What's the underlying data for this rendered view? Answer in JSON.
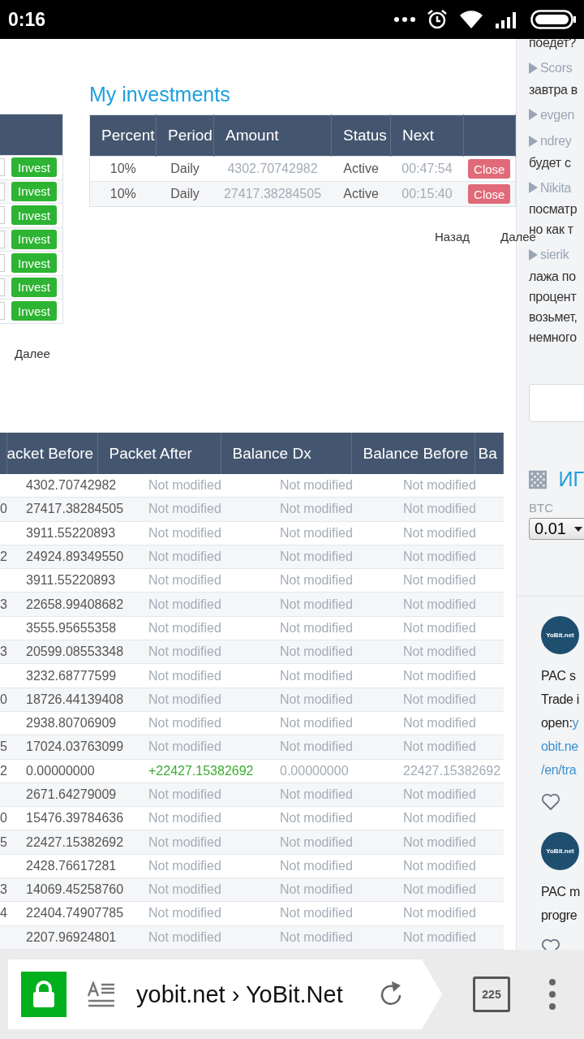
{
  "status_bar": {
    "time": "0:16"
  },
  "left_table": {
    "rows": [
      {
        "button": "Invest"
      },
      {
        "button": "Invest"
      },
      {
        "button": "Invest"
      },
      {
        "button": "Invest"
      },
      {
        "button": "Invest"
      },
      {
        "button": "Invest"
      },
      {
        "button": "Invest"
      }
    ],
    "next": "Далее"
  },
  "investments": {
    "title": "My investments",
    "columns": [
      "Percent",
      "Period",
      "Amount",
      "Status",
      "Next"
    ],
    "rows": [
      {
        "percent": "10%",
        "period": "Daily",
        "amount": "4302.70742982",
        "status": "Active",
        "next": "00:47:54",
        "button": "Close"
      },
      {
        "percent": "10%",
        "period": "Daily",
        "amount": "27417.38284505",
        "status": "Active",
        "next": "00:15:40",
        "button": "Close"
      }
    ],
    "prev": "Назад",
    "next": "Далее"
  },
  "history": {
    "columns": [
      "acket Before",
      "Packet After",
      "Balance Dx",
      "Balance Before",
      "Ba"
    ],
    "rows": [
      {
        "packet_before": "4302.70742982",
        "packet_after": "Not modified",
        "balance_dx": "Not modified",
        "balance_before": "Not modified",
        "modified": false
      },
      {
        "column_1": "0",
        "packet_before": "27417.38284505",
        "packet_after": "Not modified",
        "balance_dx": "Not modified",
        "balance_before": "Not modified",
        "modified": false
      },
      {
        "packet_before": "3911.55220893",
        "packet_after": "Not modified",
        "balance_dx": "Not modified",
        "balance_before": "Not modified",
        "modified": false
      },
      {
        "column_1": "2",
        "packet_before": "24924.89349550",
        "packet_after": "Not modified",
        "balance_dx": "Not modified",
        "balance_before": "Not modified",
        "modified": false
      },
      {
        "packet_before": "3911.55220893",
        "packet_after": "Not modified",
        "balance_dx": "Not modified",
        "balance_before": "Not modified",
        "modified": false
      },
      {
        "column_1": "3",
        "packet_before": "22658.99408682",
        "packet_after": "Not modified",
        "balance_dx": "Not modified",
        "balance_before": "Not modified",
        "modified": false
      },
      {
        "packet_before": "3555.95655358",
        "packet_after": "Not modified",
        "balance_dx": "Not modified",
        "balance_before": "Not modified",
        "modified": false
      },
      {
        "column_1": "3",
        "packet_before": "20599.08553348",
        "packet_after": "Not modified",
        "balance_dx": "Not modified",
        "balance_before": "Not modified",
        "modified": false
      },
      {
        "packet_before": "3232.68777599",
        "packet_after": "Not modified",
        "balance_dx": "Not modified",
        "balance_before": "Not modified",
        "modified": false
      },
      {
        "column_1": "0",
        "packet_before": "18726.44139408",
        "packet_after": "Not modified",
        "balance_dx": "Not modified",
        "balance_before": "Not modified",
        "modified": false
      },
      {
        "packet_before": "2938.80706909",
        "packet_after": "Not modified",
        "balance_dx": "Not modified",
        "balance_before": "Not modified",
        "modified": false
      },
      {
        "column_1": "5",
        "packet_before": "17024.03763099",
        "packet_after": "Not modified",
        "balance_dx": "Not modified",
        "balance_before": "Not modified",
        "modified": false
      },
      {
        "column_1": "2",
        "packet_before": "0.00000000",
        "packet_after": "+22427.15382692",
        "balance_dx": "0.00000000",
        "balance_before": "22427.15382692",
        "modified": true
      },
      {
        "packet_before": "2671.64279009",
        "packet_after": "Not modified",
        "balance_dx": "Not modified",
        "balance_before": "Not modified",
        "modified": false
      },
      {
        "column_1": "0",
        "packet_before": "15476.39784636",
        "packet_after": "Not modified",
        "balance_dx": "Not modified",
        "balance_before": "Not modified",
        "modified": false
      },
      {
        "column_1": "5",
        "packet_before": "22427.15382692",
        "packet_after": "Not modified",
        "balance_dx": "Not modified",
        "balance_before": "Not modified",
        "modified": false
      },
      {
        "packet_before": "2428.76617281",
        "packet_after": "Not modified",
        "balance_dx": "Not modified",
        "balance_before": "Not modified",
        "modified": false
      },
      {
        "column_1": "3",
        "packet_before": "14069.45258760",
        "packet_after": "Not modified",
        "balance_dx": "Not modified",
        "balance_before": "Not modified",
        "modified": false
      },
      {
        "column_1": "4",
        "packet_before": "22404.74907785",
        "packet_after": "Not modified",
        "balance_dx": "Not modified",
        "balance_before": "Not modified",
        "modified": false
      },
      {
        "packet_before": "2207.96924801",
        "packet_after": "Not modified",
        "balance_dx": "Not modified",
        "balance_before": "Not modified",
        "modified": false
      }
    ]
  },
  "sidebar": {
    "chat": [
      {
        "lines": [
          "поедет?"
        ]
      },
      {
        "user": "Scors",
        "lines": [
          "завтра в"
        ]
      },
      {
        "user": "evgen"
      },
      {
        "user": "ndrey",
        "lines": [
          "будет с"
        ]
      },
      {
        "user": "Nikita",
        "lines": [
          "посматр",
          "но как т"
        ]
      },
      {
        "user": "sierik",
        "lines": [
          "лажа по",
          "процент",
          "возьмет,",
          "немного"
        ]
      }
    ],
    "widget": {
      "title": "ИГ",
      "label": "BTC",
      "select_value": "0.01"
    },
    "posts": [
      {
        "logo": "YoBit.net",
        "lines": [
          {
            "text": "PAC s"
          },
          {
            "text": "Trade i"
          },
          {
            "text": "open:",
            "link": "y"
          },
          {
            "link": "obit.ne"
          },
          {
            "link": "/en/tra"
          }
        ]
      },
      {
        "logo": "YoBit.net",
        "lines": [
          {
            "text": "PAC m"
          },
          {
            "text": "progre"
          }
        ]
      }
    ]
  },
  "browser": {
    "url": "yobit.net › YoBit.Net",
    "tabs": "225"
  }
}
